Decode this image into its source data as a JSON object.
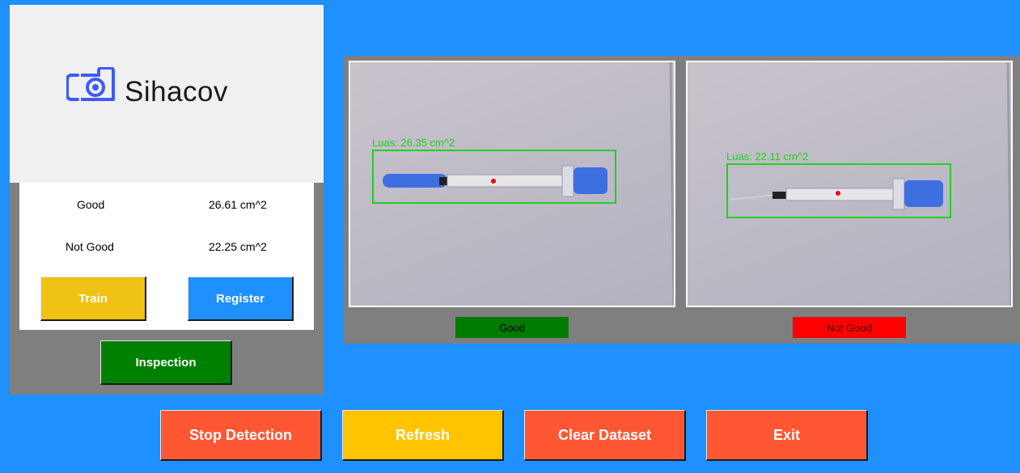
{
  "logo": {
    "text": "Sihacov",
    "icon": "camera-scan-icon"
  },
  "reference": {
    "good_label": "Good",
    "good_value": "26.61 cm^2",
    "not_good_label": "Not Good",
    "not_good_value": "22.25 cm^2"
  },
  "buttons": {
    "train": "Train",
    "register": "Register",
    "inspection": "Inspection",
    "stop_detection": "Stop Detection",
    "refresh": "Refresh",
    "clear_dataset": "Clear Dataset",
    "exit": "Exit"
  },
  "cameras": {
    "good": {
      "detection_label": "Luas: 26.35 cm^2",
      "status": "Good",
      "status_color": "#007A00"
    },
    "not_good": {
      "detection_label": "Luas: 22.11 cm^2",
      "status": "Not Good",
      "status_color": "#FF0000"
    }
  },
  "colors": {
    "background": "#1E90FF",
    "panel": "#7F7F7F",
    "train": "#F0C214",
    "register": "#1E90FF",
    "inspection": "#008000",
    "action_red": "#FF5733",
    "refresh": "#FFC300",
    "detection_box": "#1ED21E"
  }
}
